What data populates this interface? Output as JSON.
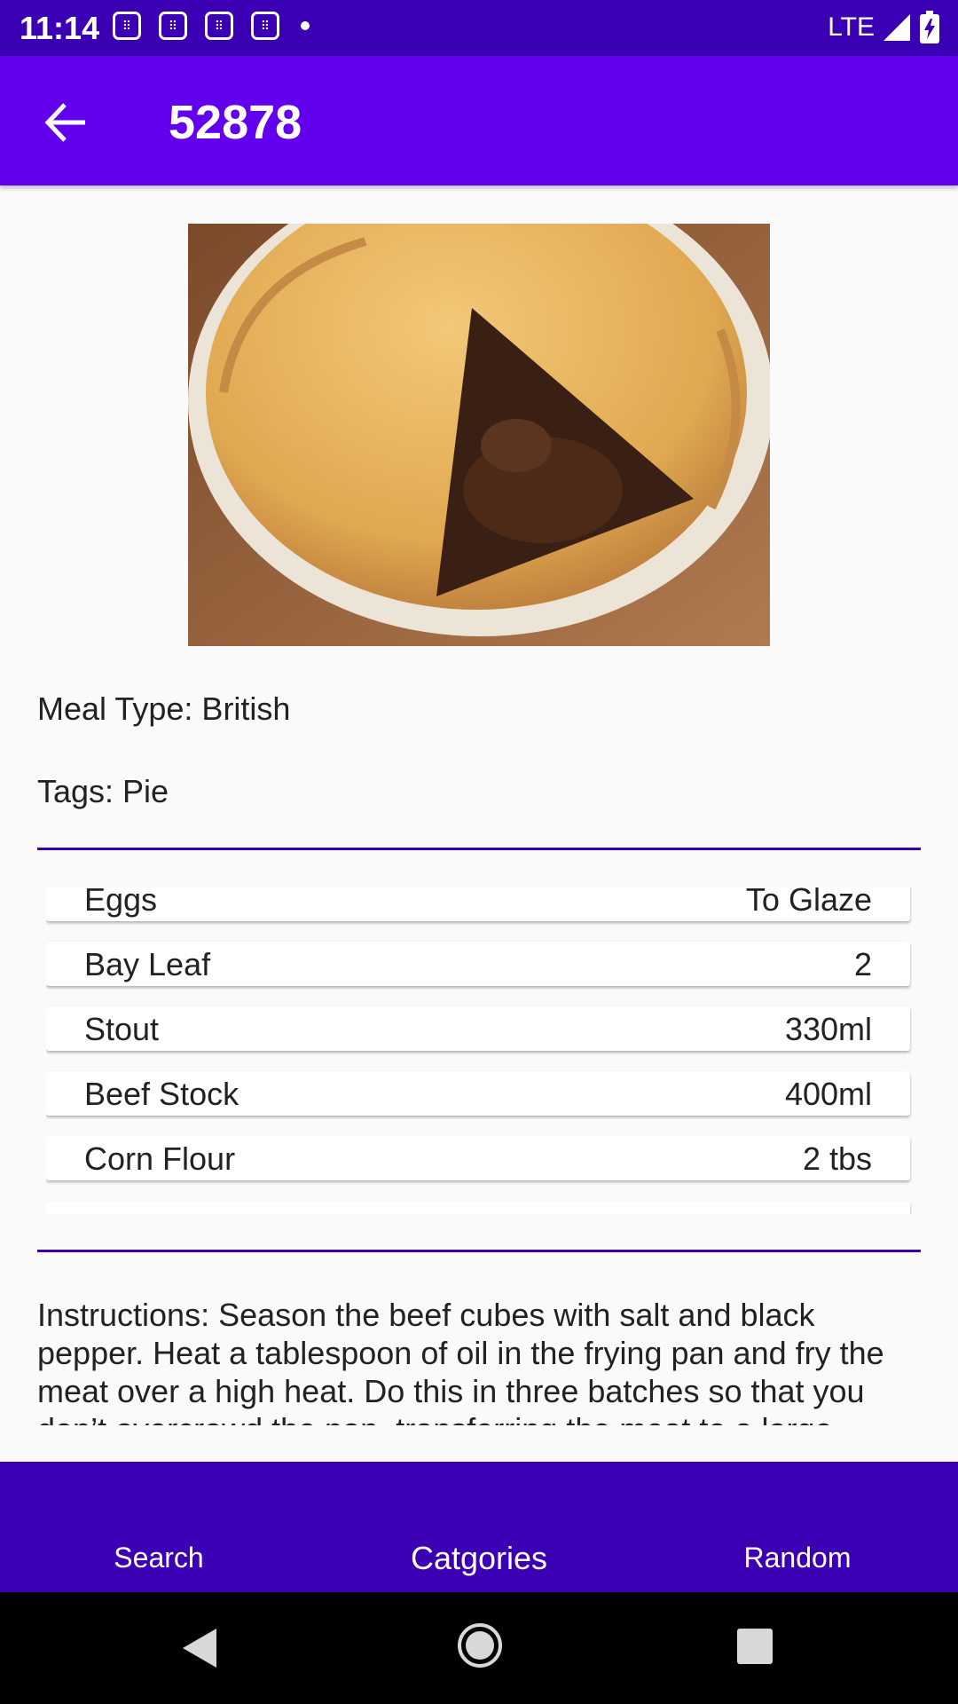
{
  "status_bar": {
    "time": "11:14",
    "network": "LTE"
  },
  "app_bar": {
    "title": "52878",
    "back_icon": "arrow-back-icon"
  },
  "meal": {
    "image_alt": "Meal image",
    "meal_type": "Meal Type: British",
    "tags": "Tags: Pie"
  },
  "ingredients": [
    {
      "name": "Eggs",
      "quantity": "To Glaze"
    },
    {
      "name": "Bay Leaf",
      "quantity": "2"
    },
    {
      "name": "Stout",
      "quantity": "330ml"
    },
    {
      "name": "Beef Stock",
      "quantity": "400ml"
    },
    {
      "name": "Corn Flour",
      "quantity": "2 tbs"
    }
  ],
  "instructions": "Instructions: Season the beef cubes with salt and black pepper. Heat a tablespoon of oil in the frying pan and fry the meat over a high heat. Do this in three batches so that you don’t overcrowd the pan, transferring the meat to a large",
  "bottom_tabs": {
    "search": "Search",
    "categories": "Catgories",
    "random": "Random"
  },
  "colors": {
    "status_bar": "#3b00b3",
    "app_bar": "#6200ee",
    "divider": "#3b00b3",
    "bottom_bar": "#3b00b3"
  }
}
